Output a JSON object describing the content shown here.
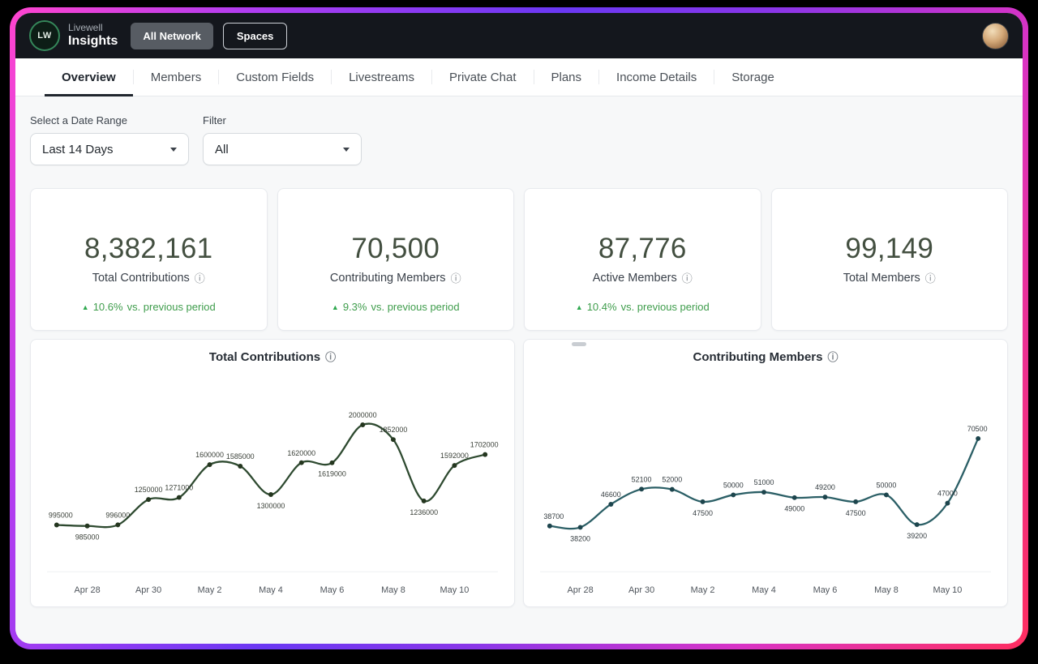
{
  "icons": {
    "info": "ⓘ",
    "up_triangle": "▲"
  },
  "header": {
    "logo_text": "LW",
    "brand_top": "Livewell",
    "brand_bottom": "Insights",
    "buttons": [
      {
        "label": "All Network",
        "active": true
      },
      {
        "label": "Spaces",
        "active": false
      }
    ]
  },
  "tabs": [
    {
      "label": "Overview",
      "active": true
    },
    {
      "label": "Members",
      "active": false
    },
    {
      "label": "Custom Fields",
      "active": false
    },
    {
      "label": "Livestreams",
      "active": false
    },
    {
      "label": "Private Chat",
      "active": false
    },
    {
      "label": "Plans",
      "active": false
    },
    {
      "label": "Income Details",
      "active": false
    },
    {
      "label": "Storage",
      "active": false
    }
  ],
  "filters": {
    "date_range_label": "Select a Date Range",
    "date_range_value": "Last 14 Days",
    "filter_label": "Filter",
    "filter_value": "All"
  },
  "stats": [
    {
      "value": "8,382,161",
      "label": "Total Contributions",
      "change": "10.6%",
      "change_suffix": "vs. previous period"
    },
    {
      "value": "70,500",
      "label": "Contributing Members",
      "change": "9.3%",
      "change_suffix": "vs. previous period"
    },
    {
      "value": "87,776",
      "label": "Active Members",
      "change": "10.4%",
      "change_suffix": "vs. previous period"
    },
    {
      "value": "99,149",
      "label": "Total Members"
    }
  ],
  "chart_data": [
    {
      "type": "line",
      "title": "Total Contributions",
      "x_ticks": [
        "Apr 28",
        "Apr 30",
        "May 2",
        "May 4",
        "May 6",
        "May 8",
        "May 10"
      ],
      "values": [
        995000,
        985000,
        996000,
        1250000,
        1271000,
        1600000,
        1585000,
        1300000,
        1620000,
        1619000,
        2000000,
        1852000,
        1236000,
        1592000,
        1702000
      ],
      "label_positions": [
        "above",
        "below",
        "above",
        "above",
        "above",
        "above",
        "above",
        "below",
        "above",
        "below",
        "above",
        "above",
        "below",
        "above",
        "above"
      ],
      "ylim": [
        800000,
        2400000
      ],
      "line_color": "#2e4a30",
      "dot_color": "#24361f",
      "label_color": "#3a4038",
      "tick_color": "#4f555c",
      "grid": false,
      "legend": "none"
    },
    {
      "type": "line",
      "title": "Contributing Members",
      "x_ticks": [
        "Apr 28",
        "Apr 30",
        "May 2",
        "May 4",
        "May 6",
        "May 8",
        "May 10"
      ],
      "values": [
        38700,
        38200,
        46600,
        52100,
        52000,
        47500,
        50000,
        51000,
        49000,
        49200,
        47500,
        50000,
        39200,
        47000,
        70500
      ],
      "label_positions": [
        "above",
        "below",
        "above",
        "above",
        "above",
        "below",
        "above",
        "above",
        "below",
        "above",
        "below",
        "above",
        "below",
        "above",
        "above"
      ],
      "ylim": [
        32000,
        90000
      ],
      "line_color": "#2b5f66",
      "dot_color": "#1d454d",
      "label_color": "#343c40",
      "tick_color": "#4f555c",
      "grid": false,
      "legend": "none"
    }
  ]
}
